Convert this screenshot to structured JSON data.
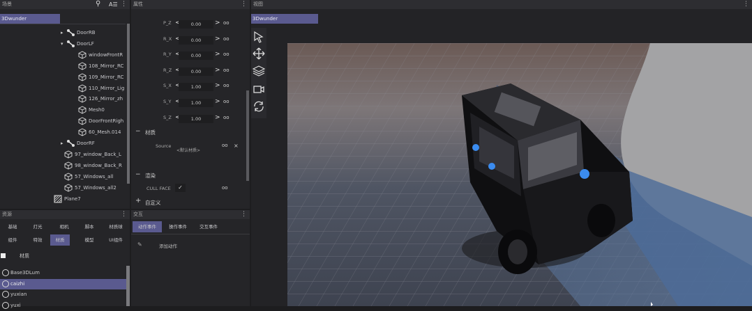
{
  "scene_tree": {
    "title": "场景",
    "tab": "3Dwunder",
    "rows": [
      {
        "label": "DoorRB",
        "arrow": "▸",
        "kind": "bone",
        "indent": 87
      },
      {
        "label": "DoorLF",
        "arrow": "▾",
        "kind": "bone",
        "indent": 87
      },
      {
        "label": "windowFrontR",
        "kind": "mesh",
        "indent": 112
      },
      {
        "label": "108_Mirror_RC",
        "kind": "mesh",
        "indent": 112
      },
      {
        "label": "109_Mirror_RC",
        "kind": "mesh",
        "indent": 112
      },
      {
        "label": "110_Mirror_Lig",
        "kind": "mesh",
        "indent": 112
      },
      {
        "label": "126_Mirror_zh",
        "kind": "mesh",
        "indent": 112
      },
      {
        "label": "Mesh0",
        "kind": "mesh",
        "indent": 112
      },
      {
        "label": "DoorFrontRigh",
        "kind": "mesh",
        "indent": 112
      },
      {
        "label": "60_Mesh.014",
        "kind": "mesh",
        "indent": 112
      },
      {
        "label": "DoorRF",
        "arrow": "▸",
        "kind": "bone",
        "indent": 87
      },
      {
        "label": "97_window_Back_L",
        "kind": "mesh",
        "indent": 92
      },
      {
        "label": "98_window_Back_R",
        "kind": "mesh",
        "indent": 92
      },
      {
        "label": "57_Windows_all",
        "kind": "mesh",
        "indent": 92
      },
      {
        "label": "57_Windows_all2",
        "kind": "mesh",
        "indent": 92
      },
      {
        "label": "Plane7",
        "kind": "plane",
        "indent": 77
      }
    ]
  },
  "resources": {
    "title": "资源",
    "row1": [
      "基础",
      "灯光",
      "相机",
      "脚本",
      "材质球"
    ],
    "row2": [
      "组件",
      "特效",
      "材质",
      "模型",
      "UI组件"
    ],
    "selected": "材质",
    "filter_label": "材质",
    "items": [
      "Base3DLum",
      "caizhi",
      "yuxian",
      "yuxi"
    ]
  },
  "properties": {
    "title": "属性",
    "rows": [
      {
        "label": "P_Z",
        "value": "0.00"
      },
      {
        "label": "R_X",
        "value": "0.00"
      },
      {
        "label": "R_Y",
        "value": "0.00"
      },
      {
        "label": "R_Z",
        "value": "0.00"
      },
      {
        "label": "S_X",
        "value": "1.00"
      },
      {
        "label": "S_Y",
        "value": "1.00"
      },
      {
        "label": "S_Z",
        "value": "1.00"
      }
    ],
    "material_header": "材质",
    "source_label": "Source",
    "source_value": "<默认材质>",
    "render_header": "渲染",
    "cullface_label": "CULL FACE",
    "custom_header": "自定义"
  },
  "events": {
    "title": "交互",
    "tabs": [
      "动作事件",
      "操作事件",
      "交互事件"
    ],
    "add_label": "添加动作"
  },
  "viewport": {
    "title": "视图",
    "tab": "3Dwunder"
  },
  "colors": {
    "accent": "#5a5a8f",
    "panel": "#252528",
    "header": "#2d2d31"
  }
}
